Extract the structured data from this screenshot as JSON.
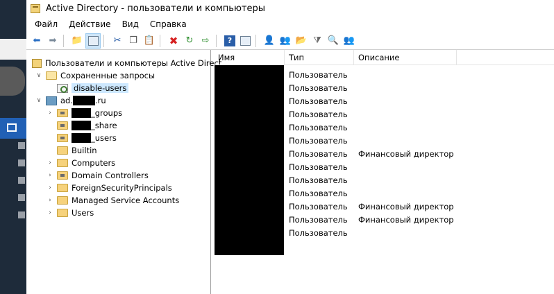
{
  "window": {
    "title": "Active Directory - пользователи и компьютеры"
  },
  "menu": [
    "Файл",
    "Действие",
    "Вид",
    "Справка"
  ],
  "toolbar_icons": [
    "back-arrow-icon",
    "forward-arrow-icon",
    "up-folder-icon",
    "show-hide-tree-icon",
    "cut-icon",
    "copy-icon",
    "paste-icon",
    "delete-icon",
    "refresh-icon",
    "export-list-icon",
    "help-icon",
    "properties-icon",
    "add-user-icon",
    "add-group-icon",
    "add-ou-icon",
    "filter-icon",
    "find-icon",
    "add-to-group-icon"
  ],
  "tree": {
    "root": "Пользователи и компьютеры Active Direct",
    "saved_queries": "Сохраненные запросы",
    "query": "disable-users",
    "domain_prefix": "ad.",
    "domain_suffix": ".ru",
    "groups": "_groups",
    "share": "_share",
    "users_ou": "_users",
    "builtin": "Builtin",
    "computers": "Computers",
    "domain_controllers": "Domain Controllers",
    "foreign": "ForeignSecurityPrincipals",
    "msa": "Managed Service Accounts",
    "users": "Users"
  },
  "list": {
    "columns": [
      "Имя",
      "Тип",
      "Описание"
    ],
    "rows": [
      {
        "type": "Пользователь",
        "desc": ""
      },
      {
        "type": "Пользователь",
        "desc": ""
      },
      {
        "type": "Пользователь",
        "desc": ""
      },
      {
        "type": "Пользователь",
        "desc": ""
      },
      {
        "type": "Пользователь",
        "desc": ""
      },
      {
        "type": "Пользователь",
        "desc": ""
      },
      {
        "type": "Пользователь",
        "desc": "Финансовый директор"
      },
      {
        "type": "Пользователь",
        "desc": ""
      },
      {
        "type": "Пользователь",
        "desc": ""
      },
      {
        "type": "Пользователь",
        "desc": ""
      },
      {
        "type": "Пользователь",
        "desc": "Финансовый директор"
      },
      {
        "type": "Пользователь",
        "desc": "Финансовый директор"
      },
      {
        "type": "Пользователь",
        "desc": ""
      }
    ]
  }
}
